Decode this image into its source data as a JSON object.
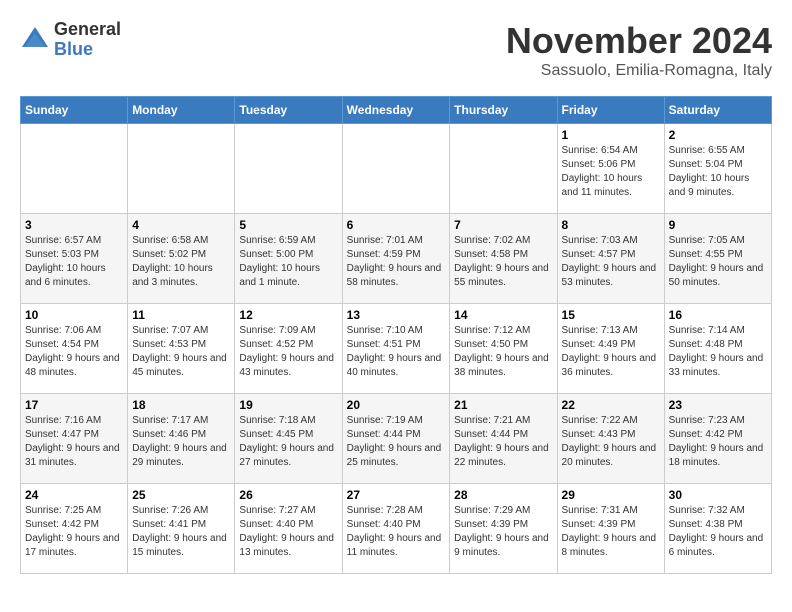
{
  "logo": {
    "general": "General",
    "blue": "Blue"
  },
  "title": "November 2024",
  "location": "Sassuolo, Emilia-Romagna, Italy",
  "weekdays": [
    "Sunday",
    "Monday",
    "Tuesday",
    "Wednesday",
    "Thursday",
    "Friday",
    "Saturday"
  ],
  "weeks": [
    [
      {
        "day": "",
        "info": ""
      },
      {
        "day": "",
        "info": ""
      },
      {
        "day": "",
        "info": ""
      },
      {
        "day": "",
        "info": ""
      },
      {
        "day": "",
        "info": ""
      },
      {
        "day": "1",
        "info": "Sunrise: 6:54 AM\nSunset: 5:06 PM\nDaylight: 10 hours and 11 minutes."
      },
      {
        "day": "2",
        "info": "Sunrise: 6:55 AM\nSunset: 5:04 PM\nDaylight: 10 hours and 9 minutes."
      }
    ],
    [
      {
        "day": "3",
        "info": "Sunrise: 6:57 AM\nSunset: 5:03 PM\nDaylight: 10 hours and 6 minutes."
      },
      {
        "day": "4",
        "info": "Sunrise: 6:58 AM\nSunset: 5:02 PM\nDaylight: 10 hours and 3 minutes."
      },
      {
        "day": "5",
        "info": "Sunrise: 6:59 AM\nSunset: 5:00 PM\nDaylight: 10 hours and 1 minute."
      },
      {
        "day": "6",
        "info": "Sunrise: 7:01 AM\nSunset: 4:59 PM\nDaylight: 9 hours and 58 minutes."
      },
      {
        "day": "7",
        "info": "Sunrise: 7:02 AM\nSunset: 4:58 PM\nDaylight: 9 hours and 55 minutes."
      },
      {
        "day": "8",
        "info": "Sunrise: 7:03 AM\nSunset: 4:57 PM\nDaylight: 9 hours and 53 minutes."
      },
      {
        "day": "9",
        "info": "Sunrise: 7:05 AM\nSunset: 4:55 PM\nDaylight: 9 hours and 50 minutes."
      }
    ],
    [
      {
        "day": "10",
        "info": "Sunrise: 7:06 AM\nSunset: 4:54 PM\nDaylight: 9 hours and 48 minutes."
      },
      {
        "day": "11",
        "info": "Sunrise: 7:07 AM\nSunset: 4:53 PM\nDaylight: 9 hours and 45 minutes."
      },
      {
        "day": "12",
        "info": "Sunrise: 7:09 AM\nSunset: 4:52 PM\nDaylight: 9 hours and 43 minutes."
      },
      {
        "day": "13",
        "info": "Sunrise: 7:10 AM\nSunset: 4:51 PM\nDaylight: 9 hours and 40 minutes."
      },
      {
        "day": "14",
        "info": "Sunrise: 7:12 AM\nSunset: 4:50 PM\nDaylight: 9 hours and 38 minutes."
      },
      {
        "day": "15",
        "info": "Sunrise: 7:13 AM\nSunset: 4:49 PM\nDaylight: 9 hours and 36 minutes."
      },
      {
        "day": "16",
        "info": "Sunrise: 7:14 AM\nSunset: 4:48 PM\nDaylight: 9 hours and 33 minutes."
      }
    ],
    [
      {
        "day": "17",
        "info": "Sunrise: 7:16 AM\nSunset: 4:47 PM\nDaylight: 9 hours and 31 minutes."
      },
      {
        "day": "18",
        "info": "Sunrise: 7:17 AM\nSunset: 4:46 PM\nDaylight: 9 hours and 29 minutes."
      },
      {
        "day": "19",
        "info": "Sunrise: 7:18 AM\nSunset: 4:45 PM\nDaylight: 9 hours and 27 minutes."
      },
      {
        "day": "20",
        "info": "Sunrise: 7:19 AM\nSunset: 4:44 PM\nDaylight: 9 hours and 25 minutes."
      },
      {
        "day": "21",
        "info": "Sunrise: 7:21 AM\nSunset: 4:44 PM\nDaylight: 9 hours and 22 minutes."
      },
      {
        "day": "22",
        "info": "Sunrise: 7:22 AM\nSunset: 4:43 PM\nDaylight: 9 hours and 20 minutes."
      },
      {
        "day": "23",
        "info": "Sunrise: 7:23 AM\nSunset: 4:42 PM\nDaylight: 9 hours and 18 minutes."
      }
    ],
    [
      {
        "day": "24",
        "info": "Sunrise: 7:25 AM\nSunset: 4:42 PM\nDaylight: 9 hours and 17 minutes."
      },
      {
        "day": "25",
        "info": "Sunrise: 7:26 AM\nSunset: 4:41 PM\nDaylight: 9 hours and 15 minutes."
      },
      {
        "day": "26",
        "info": "Sunrise: 7:27 AM\nSunset: 4:40 PM\nDaylight: 9 hours and 13 minutes."
      },
      {
        "day": "27",
        "info": "Sunrise: 7:28 AM\nSunset: 4:40 PM\nDaylight: 9 hours and 11 minutes."
      },
      {
        "day": "28",
        "info": "Sunrise: 7:29 AM\nSunset: 4:39 PM\nDaylight: 9 hours and 9 minutes."
      },
      {
        "day": "29",
        "info": "Sunrise: 7:31 AM\nSunset: 4:39 PM\nDaylight: 9 hours and 8 minutes."
      },
      {
        "day": "30",
        "info": "Sunrise: 7:32 AM\nSunset: 4:38 PM\nDaylight: 9 hours and 6 minutes."
      }
    ]
  ]
}
